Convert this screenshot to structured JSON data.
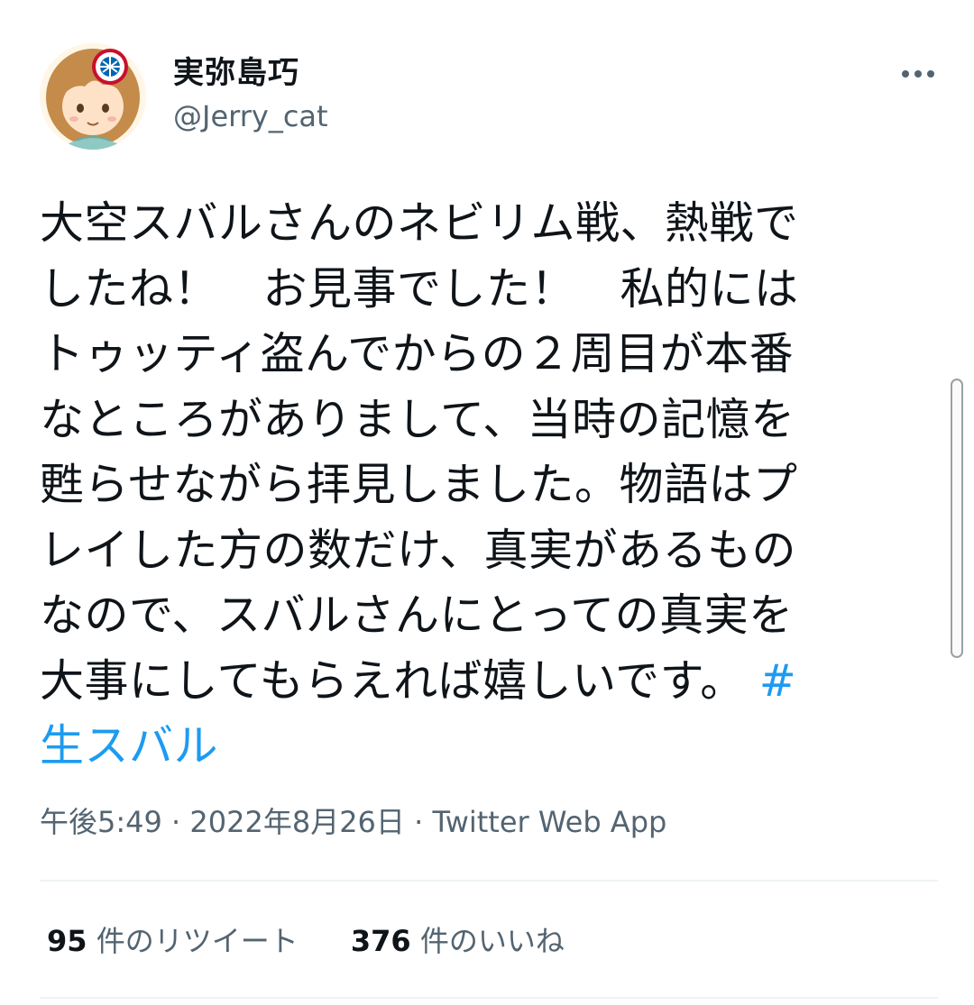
{
  "user": {
    "display_name": "実弥島巧",
    "handle": "@Jerry_cat"
  },
  "tweet": {
    "lines": [
      "大空スバルさんのネビリム戦、熱戦で",
      "したね！　お見事でした！　私的には",
      "トゥッティ盗んでからの２周目が本番",
      "なところがありまして、当時の記憶を",
      "甦らせながら拝見しました。物語はプ",
      "レイした方の数だけ、真実があるもの",
      "なので、スバルさんにとっての真実を"
    ],
    "last_line": "大事にしてもらえれば嬉しいです。",
    "hashtag_part1": "#",
    "hashtag_part2": "生スバル"
  },
  "meta": {
    "time": "午後5:49",
    "date": "2022年8月26日",
    "source": "Twitter Web App",
    "separator": "·"
  },
  "stats": {
    "retweets_count": "95",
    "retweets_label": "件のリツイート",
    "likes_count": "376",
    "likes_label": "件のいいね"
  },
  "icons": {
    "more": "more-horizontal-icon",
    "avatar_badge": "fc-bayern-badge-icon"
  }
}
